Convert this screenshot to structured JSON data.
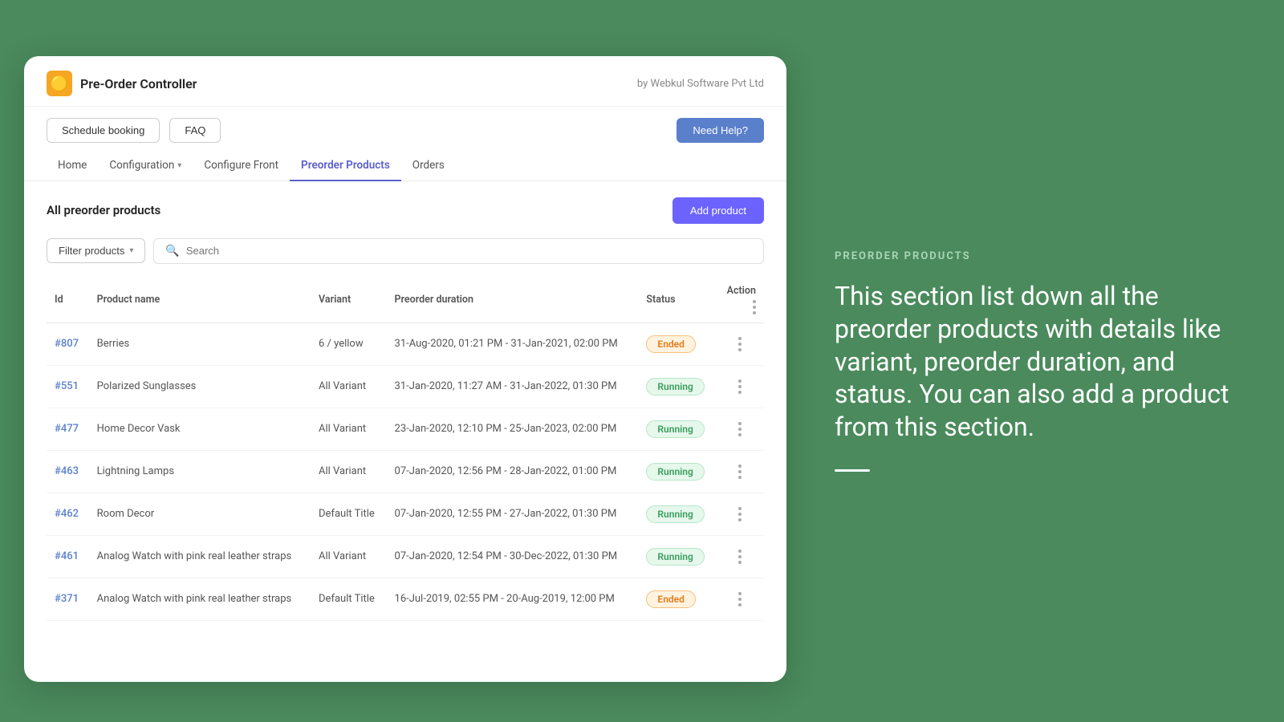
{
  "app": {
    "logo_emoji": "🟡",
    "title": "Pre-Order Controller",
    "by_label": "by Webkul Software Pvt Ltd"
  },
  "toolbar": {
    "schedule_booking": "Schedule booking",
    "faq": "FAQ",
    "need_help": "Need Help?"
  },
  "nav": {
    "tabs": [
      {
        "label": "Home",
        "active": false
      },
      {
        "label": "Configuration",
        "active": false,
        "dropdown": true
      },
      {
        "label": "Configure Front",
        "active": false
      },
      {
        "label": "Preorder Products",
        "active": true
      },
      {
        "label": "Orders",
        "active": false
      }
    ]
  },
  "content": {
    "section_title": "All preorder products",
    "add_product_btn": "Add product",
    "filter_btn": "Filter products",
    "search_placeholder": "Search"
  },
  "table": {
    "columns": [
      "Id",
      "Product name",
      "Variant",
      "Preorder duration",
      "Status",
      "Action"
    ],
    "rows": [
      {
        "id": "#807",
        "name": "Berries",
        "variant": "6 / yellow",
        "duration": "31-Aug-2020, 01:21 PM - 31-Jan-2021, 02:00 PM",
        "status": "Ended",
        "status_type": "ended"
      },
      {
        "id": "#551",
        "name": "Polarized Sunglasses",
        "variant": "All Variant",
        "duration": "31-Jan-2020, 11:27 AM - 31-Jan-2022, 01:30 PM",
        "status": "Running",
        "status_type": "running"
      },
      {
        "id": "#477",
        "name": "Home Decor Vask",
        "variant": "All Variant",
        "duration": "23-Jan-2020, 12:10 PM - 25-Jan-2023, 02:00 PM",
        "status": "Running",
        "status_type": "running"
      },
      {
        "id": "#463",
        "name": "Lightning Lamps",
        "variant": "All Variant",
        "duration": "07-Jan-2020, 12:56 PM - 28-Jan-2022, 01:00 PM",
        "status": "Running",
        "status_type": "running"
      },
      {
        "id": "#462",
        "name": "Room Decor",
        "variant": "Default Title",
        "duration": "07-Jan-2020, 12:55 PM - 27-Jan-2022, 01:30 PM",
        "status": "Running",
        "status_type": "running"
      },
      {
        "id": "#461",
        "name": "Analog Watch with pink real leather straps",
        "variant": "All Variant",
        "duration": "07-Jan-2020, 12:54 PM - 30-Dec-2022, 01:30 PM",
        "status": "Running",
        "status_type": "running"
      },
      {
        "id": "#371",
        "name": "Analog Watch with pink real leather straps",
        "variant": "Default Title",
        "duration": "16-Jul-2019, 02:55 PM - 20-Aug-2019, 12:00 PM",
        "status": "Ended",
        "status_type": "ended"
      }
    ]
  },
  "right_panel": {
    "label": "PREORDER PRODUCTS",
    "description": "This section list down all the preorder products with details like variant, preorder duration, and status. You can also add a product from this section."
  }
}
